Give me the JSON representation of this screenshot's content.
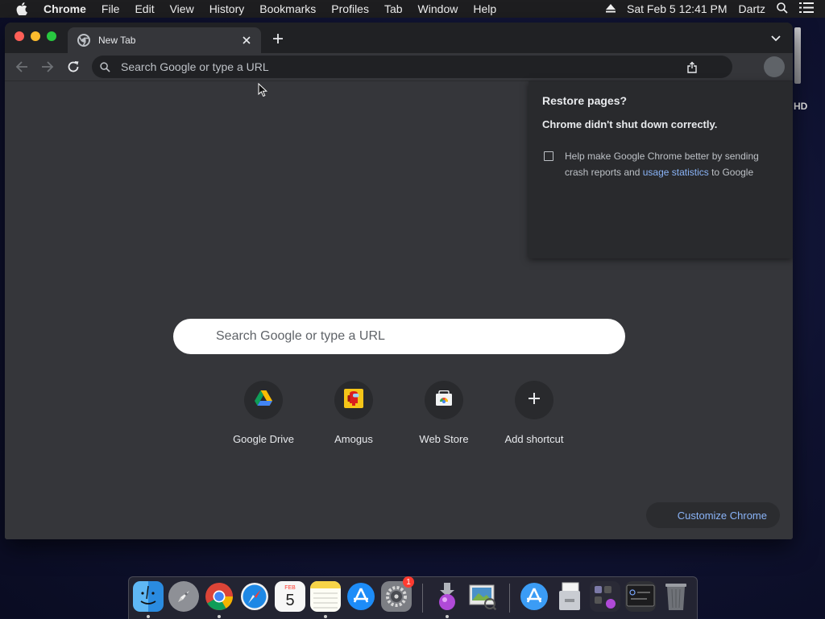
{
  "menubar": {
    "app_name": "Chrome",
    "menus": [
      "File",
      "Edit",
      "View",
      "History",
      "Bookmarks",
      "Profiles",
      "Tab",
      "Window",
      "Help"
    ],
    "datetime": "Sat Feb 5  12:41 PM",
    "user": "Dartz"
  },
  "desktop": {
    "drive_label": "HD"
  },
  "browser": {
    "tab": {
      "title": "New Tab"
    },
    "omnibox": {
      "placeholder": "Search Google or type a URL",
      "value": ""
    }
  },
  "restore_popup": {
    "title": "Restore pages?",
    "message": "Chrome didn't shut down correctly.",
    "checkbox_checked": false,
    "checkbox_text_before": "Help make Google Chrome better by sending crash reports and ",
    "checkbox_link": "usage statistics",
    "checkbox_text_after": " to Google"
  },
  "ntp": {
    "search_placeholder": "Search Google or type a URL",
    "shortcuts": [
      {
        "label": "Google Drive",
        "icon": "google-drive-icon"
      },
      {
        "label": "Amogus",
        "icon": "among-us-icon"
      },
      {
        "label": "Web Store",
        "icon": "web-store-icon"
      },
      {
        "label": "Add shortcut",
        "icon": "plus-icon"
      }
    ],
    "customize_label": "Customize Chrome"
  },
  "dock": {
    "items": [
      "finder-icon",
      "launchpad-icon",
      "chrome-icon",
      "safari-icon",
      "calendar-icon",
      "notes-icon",
      "app-store-icon",
      "system-preferences-icon",
      "installer-icon",
      "preview-icon",
      "app-store-folder-icon",
      "documents-folder-icon",
      "stack-icon",
      "terminal-icon",
      "trash-icon"
    ],
    "calendar_month": "FEB",
    "calendar_day": "5",
    "system_preferences_badge": "1"
  },
  "colors": {
    "window_bg": "#35363a",
    "tabstrip_bg": "#202124",
    "link_blue": "#8ab4f8",
    "close_red": "#ff5f57",
    "minimize_yellow": "#febc2e",
    "maximize_green": "#28c840"
  }
}
